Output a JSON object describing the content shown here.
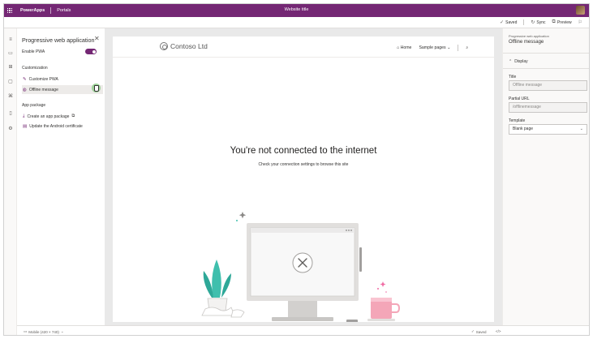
{
  "topbar": {
    "brand": "PowerApps",
    "nav": "Portals",
    "site_title": "Website title"
  },
  "commandbar": {
    "saved": "Saved",
    "sync": "Sync",
    "preview": "Preview"
  },
  "left_panel": {
    "title": "Progressive web application",
    "enable_label": "Enable PWA",
    "enable_on": true,
    "customization_heading": "Customization",
    "customize_item": "Customize PWA",
    "offline_item": "Offline message",
    "package_heading": "App package",
    "create_package": "Create an app package",
    "update_cert": "Update the Android certificate"
  },
  "canvas": {
    "logo": "Contoso Ltd",
    "nav_home": "Home",
    "nav_sample": "Sample pages",
    "heading": "You're not connected to the internet",
    "subtext": "Check your connection settings to browse this site"
  },
  "right_panel": {
    "crumb": "Progressive web application",
    "title": "Offline message",
    "section": "Display",
    "title_label": "Title",
    "title_value": "Offline message",
    "url_label": "Partial URL",
    "url_value": "/offlinemessage",
    "template_label": "Template",
    "template_value": "Blank page"
  },
  "statusbar": {
    "device": "Mobile (420 × 740)",
    "saved": "Saved"
  },
  "colors": {
    "brand": "#742774",
    "plant": "#3fbfad",
    "mug": "#f4a6b8"
  }
}
